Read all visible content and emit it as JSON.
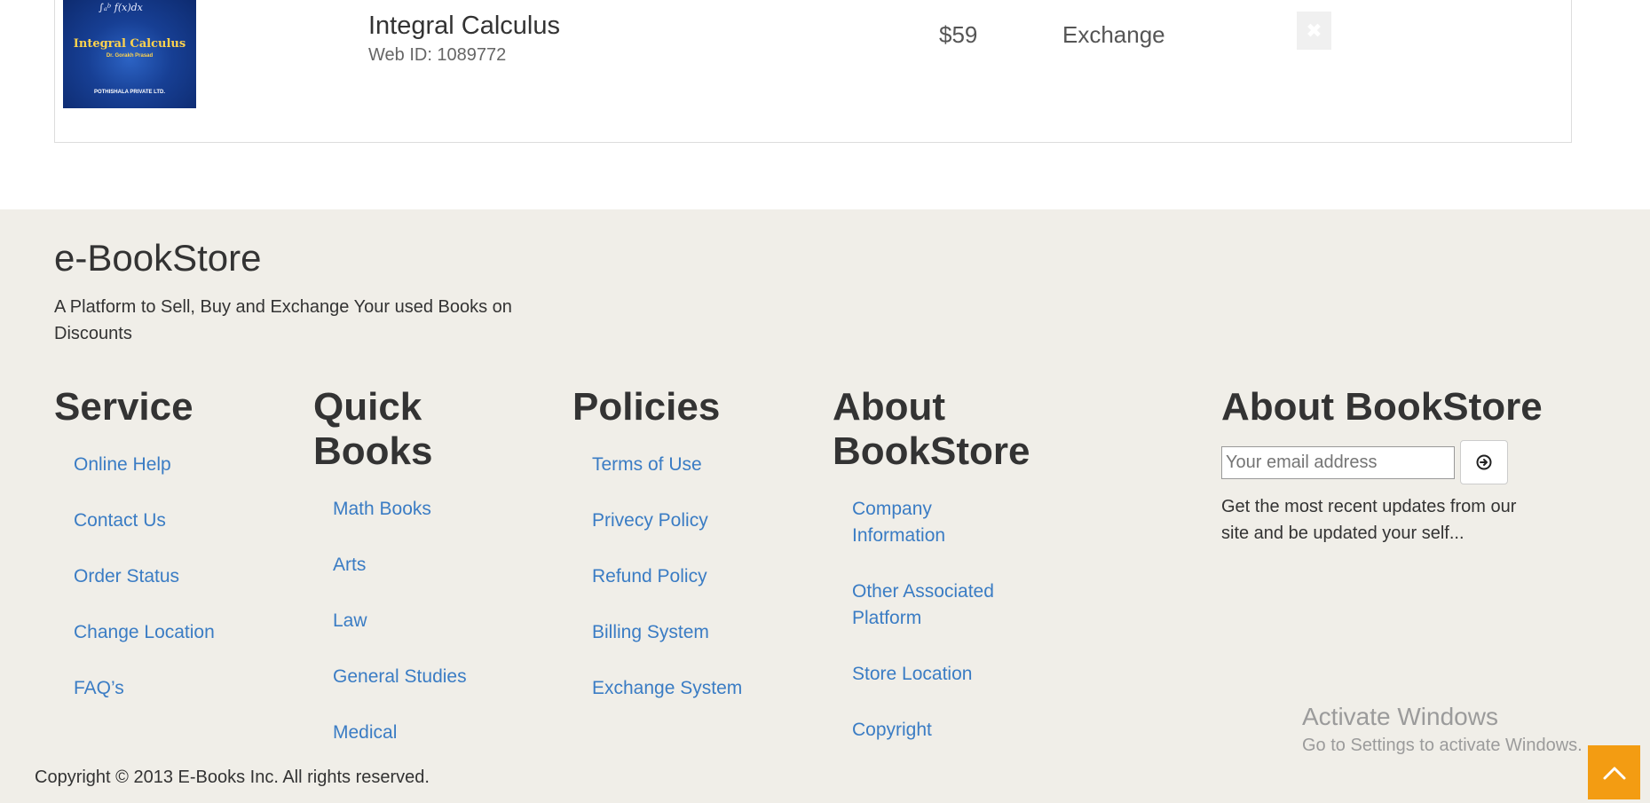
{
  "cart_item": {
    "cover": {
      "formula": "∫ₐᵇ f(x)dx",
      "title": "Integral Calculus",
      "author": "Dr. Gorakh Prasad",
      "publisher": "POTHISHALA PRIVATE LTD."
    },
    "title": "Integral Calculus",
    "web_id": "Web ID: 1089772",
    "price": "$59",
    "type": "Exchange",
    "remove_icon": "close-icon",
    "remove_glyph": "✖"
  },
  "footer": {
    "brand": "e-BookStore",
    "tagline": "A Platform to Sell, Buy and Exchange Your used Books on Discounts",
    "service": {
      "heading": "Service",
      "links": [
        "Online Help",
        "Contact Us",
        "Order Status",
        "Change Location",
        "FAQ’s"
      ]
    },
    "quick_books": {
      "heading": "Quick Books",
      "links": [
        "Math Books",
        "Arts",
        "Law",
        "General Studies",
        "Medical"
      ]
    },
    "policies": {
      "heading": "Policies",
      "links": [
        "Terms of Use",
        "Privecy Policy",
        "Refund Policy",
        "Billing System",
        "Exchange System"
      ]
    },
    "about": {
      "heading": "About BookStore",
      "links": [
        "Company Information",
        "Other Associated Platform",
        "Store Location",
        "Copyright"
      ]
    },
    "newsletter": {
      "heading": "About BookStore",
      "email_placeholder": "Your email address",
      "submit_icon": "arrow-circle-right-icon",
      "description": "Get the most recent updates from our site and be updated your self..."
    },
    "copyright": "Copyright © 2013 E-Books Inc. All rights reserved."
  },
  "watermark": {
    "line1": "Activate Windows",
    "line2": "Go to Settings to activate Windows."
  },
  "scroll_top_icon": "chevron-up-icon",
  "colors": {
    "link": "#3a7cc4",
    "footer_bg": "#f0eee8",
    "scroll_top_bg": "#f39c12"
  }
}
